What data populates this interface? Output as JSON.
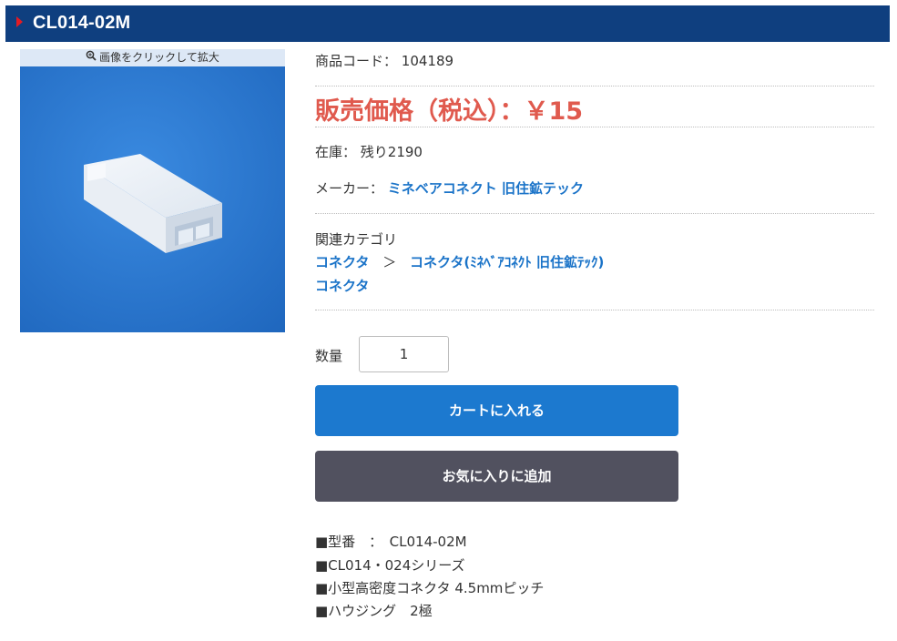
{
  "header": {
    "title": "CL014-02M"
  },
  "image": {
    "caption": "画像をクリックして拡大"
  },
  "product": {
    "code_label": "商品コード：",
    "code_value": "104189",
    "price_text": "販売価格（税込）：￥15",
    "stock_label": "在庫：",
    "stock_value": "残り2190",
    "maker_label": "メーカー：",
    "maker_value": "ミネベアコネクト 旧住鉱テック",
    "category_label": "関連カテゴリ",
    "category_1": "コネクタ",
    "category_sep": "＞",
    "category_2": "コネクタ(ﾐﾈﾍﾞｱｺﾈｸﾄ 旧住鉱ﾃｯｸ)",
    "category_3": "コネクタ"
  },
  "quantity": {
    "label": "数量",
    "value": "1"
  },
  "buttons": {
    "cart": "カートに入れる",
    "favorite": "お気に入りに追加"
  },
  "specs": [
    "■型番　：　CL014-02M",
    "■CL014・024シリーズ",
    "■小型高密度コネクタ 4.5mmピッチ",
    "■ハウジング　2極"
  ],
  "colors": {
    "header_bg": "#0f3f7f",
    "price": "#e05a4e",
    "link": "#1a73c8",
    "cart_btn": "#1c79cf",
    "fav_btn": "#51515f"
  },
  "icons": {
    "zoom": "zoom-in-icon",
    "header_marker": "triangle-marker-icon"
  }
}
